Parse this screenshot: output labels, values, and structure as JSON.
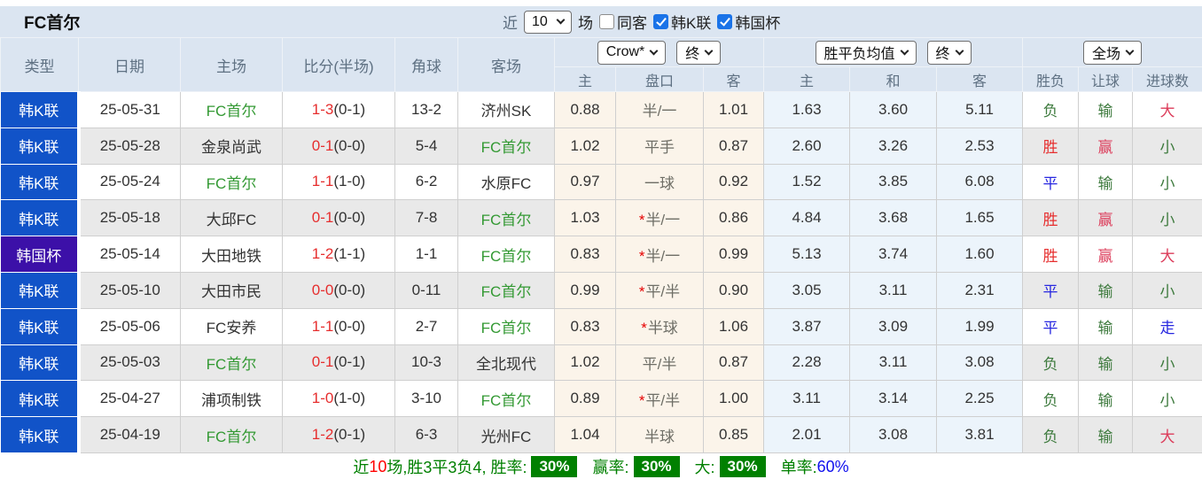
{
  "topbar": {
    "title": "FC首尔",
    "recent_label": "近",
    "recent_value": "10",
    "matches_label": "场",
    "same_venue_label": "同客",
    "same_venue_checked": false,
    "league_filters": [
      {
        "label": "韩K联",
        "checked": true
      },
      {
        "label": "韩国杯",
        "checked": true
      }
    ]
  },
  "table": {
    "headers": {
      "type": "类型",
      "date": "日期",
      "home": "主场",
      "score": "比分(半场)",
      "corner": "角球",
      "away": "客场",
      "odds_group": {
        "bookmaker": "Crow*",
        "stage": "终",
        "sub": [
          "主",
          "盘口",
          "客"
        ]
      },
      "avg_group": {
        "label": "胜平负均值",
        "stage": "终",
        "sub": [
          "主",
          "和",
          "客"
        ]
      },
      "result_group": {
        "scope": "全场",
        "sub": [
          "胜负",
          "让球",
          "进球数"
        ]
      }
    },
    "rows": [
      {
        "league": "韩K联",
        "league_color": "blue",
        "date": "25-05-31",
        "home": "FC首尔",
        "home_fc": true,
        "score": "1-3",
        "half": "(0-1)",
        "corner": "13-2",
        "away": "济州SK",
        "away_fc": false,
        "odds": [
          "0.88",
          "半/一",
          "1.01"
        ],
        "star": false,
        "avg": [
          "1.63",
          "3.60",
          "5.11"
        ],
        "avg_highlight": -1,
        "outcome": "负",
        "outcome_color": "green",
        "cover": "输",
        "cover_color": "green",
        "goals": "大",
        "goals_color": "crimson"
      },
      {
        "league": "韩K联",
        "league_color": "blue",
        "date": "25-05-28",
        "home": "金泉尚武",
        "home_fc": false,
        "score": "0-1",
        "half": "(0-0)",
        "corner": "5-4",
        "away": "FC首尔",
        "away_fc": true,
        "odds": [
          "1.02",
          "平手",
          "0.87"
        ],
        "star": false,
        "avg": [
          "2.60",
          "3.26",
          "2.53"
        ],
        "avg_highlight": -1,
        "outcome": "胜",
        "outcome_color": "red",
        "cover": "赢",
        "cover_color": "crimson",
        "goals": "小",
        "goals_color": "green"
      },
      {
        "league": "韩K联",
        "league_color": "blue",
        "date": "25-05-24",
        "home": "FC首尔",
        "home_fc": true,
        "score": "1-1",
        "half": "(1-0)",
        "corner": "6-2",
        "away": "水原FC",
        "away_fc": false,
        "odds": [
          "0.97",
          "一球",
          "0.92"
        ],
        "star": false,
        "avg": [
          "1.52",
          "3.85",
          "6.08"
        ],
        "avg_highlight": -1,
        "outcome": "平",
        "outcome_color": "blue",
        "cover": "输",
        "cover_color": "green",
        "goals": "小",
        "goals_color": "green"
      },
      {
        "league": "韩K联",
        "league_color": "blue",
        "date": "25-05-18",
        "home": "大邱FC",
        "home_fc": false,
        "score": "0-1",
        "half": "(0-0)",
        "corner": "7-8",
        "away": "FC首尔",
        "away_fc": true,
        "odds": [
          "1.03",
          "半/一",
          "0.86"
        ],
        "star": true,
        "avg": [
          "4.84",
          "3.68",
          "1.65"
        ],
        "avg_highlight": -1,
        "outcome": "胜",
        "outcome_color": "red",
        "cover": "赢",
        "cover_color": "crimson",
        "goals": "小",
        "goals_color": "green"
      },
      {
        "league": "韩国杯",
        "league_color": "purple",
        "date": "25-05-14",
        "home": "大田地铁",
        "home_fc": false,
        "score": "1-2",
        "half": "(1-1)",
        "corner": "1-1",
        "away": "FC首尔",
        "away_fc": true,
        "odds": [
          "0.83",
          "半/一",
          "0.99"
        ],
        "star": true,
        "avg": [
          "5.13",
          "3.74",
          "1.60"
        ],
        "avg_highlight": -1,
        "outcome": "胜",
        "outcome_color": "red",
        "cover": "赢",
        "cover_color": "crimson",
        "goals": "大",
        "goals_color": "crimson"
      },
      {
        "league": "韩K联",
        "league_color": "blue",
        "date": "25-05-10",
        "home": "大田市民",
        "home_fc": false,
        "score": "0-0",
        "half": "(0-0)",
        "corner": "0-11",
        "away": "FC首尔",
        "away_fc": true,
        "odds": [
          "0.99",
          "平/半",
          "0.90"
        ],
        "star": true,
        "avg": [
          "3.05",
          "3.11",
          "2.31"
        ],
        "avg_highlight": -1,
        "outcome": "平",
        "outcome_color": "blue",
        "cover": "输",
        "cover_color": "green",
        "goals": "小",
        "goals_color": "green"
      },
      {
        "league": "韩K联",
        "league_color": "blue",
        "date": "25-05-06",
        "home": "FC安养",
        "home_fc": false,
        "score": "1-1",
        "half": "(0-0)",
        "corner": "2-7",
        "away": "FC首尔",
        "away_fc": true,
        "odds": [
          "0.83",
          "半球",
          "1.06"
        ],
        "star": true,
        "avg": [
          "3.87",
          "3.09",
          "1.99"
        ],
        "avg_highlight": -1,
        "outcome": "平",
        "outcome_color": "blue",
        "cover": "输",
        "cover_color": "green",
        "goals": "走",
        "goals_color": "blue"
      },
      {
        "league": "韩K联",
        "league_color": "blue",
        "date": "25-05-03",
        "home": "FC首尔",
        "home_fc": true,
        "score": "0-1",
        "half": "(0-1)",
        "corner": "10-3",
        "away": "全北现代",
        "away_fc": false,
        "odds": [
          "1.02",
          "平/半",
          "0.87"
        ],
        "star": false,
        "avg": [
          "2.28",
          "3.11",
          "3.08"
        ],
        "avg_highlight": -1,
        "outcome": "负",
        "outcome_color": "green",
        "cover": "输",
        "cover_color": "green",
        "goals": "小",
        "goals_color": "green"
      },
      {
        "league": "韩K联",
        "league_color": "blue",
        "date": "25-04-27",
        "home": "浦项制铁",
        "home_fc": false,
        "score": "1-0",
        "half": "(1-0)",
        "corner": "3-10",
        "away": "FC首尔",
        "away_fc": true,
        "odds": [
          "0.89",
          "平/半",
          "1.00"
        ],
        "star": true,
        "avg": [
          "3.11",
          "3.14",
          "2.25"
        ],
        "avg_highlight": -1,
        "outcome": "负",
        "outcome_color": "green",
        "cover": "输",
        "cover_color": "green",
        "goals": "小",
        "goals_color": "green"
      },
      {
        "league": "韩K联",
        "league_color": "blue",
        "date": "25-04-19",
        "home": "FC首尔",
        "home_fc": true,
        "score": "1-2",
        "half": "(0-1)",
        "corner": "6-3",
        "away": "光州FC",
        "away_fc": false,
        "odds": [
          "1.04",
          "半球",
          "0.85"
        ],
        "star": false,
        "avg": [
          "2.01",
          "3.08",
          "3.81"
        ],
        "avg_highlight": 1,
        "outcome": "负",
        "outcome_color": "green",
        "cover": "输",
        "cover_color": "green",
        "goals": "大",
        "goals_color": "crimson"
      }
    ]
  },
  "summary": {
    "prefix": "近",
    "count": "10",
    "record": "场,胜3平3负4, 胜率:",
    "win_rate": "30%",
    "cover_label": "赢率:",
    "cover_rate": "30%",
    "big_label": "大:",
    "big_rate": "30%",
    "single_label": "单率:",
    "single_rate": "60%"
  },
  "colors": {
    "header_bg": "#dbe5f1",
    "league_blue": "#1153c8",
    "cup_purple": "#3c10a8",
    "fc_green": "#339933",
    "win_red": "#e62e2e",
    "draw_blue": "#2727e0",
    "lose_green": "#3d7a3d",
    "cover_crimson": "#dc3c5a",
    "highlight_orange": "#f25c22",
    "rate_green": "#008000",
    "rate_blue": "#1010ee",
    "stripe_gray": "#e9e9e9",
    "odds_cream": "#fbf4ea",
    "avg_blue": "#ecf4fb"
  }
}
